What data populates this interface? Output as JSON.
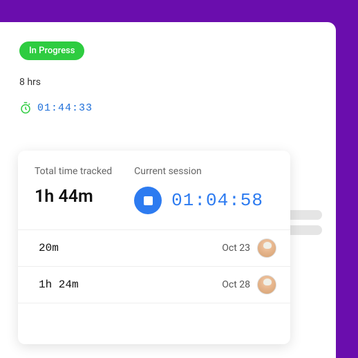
{
  "status": {
    "label": "In Progress"
  },
  "summary": {
    "hours": "8 hrs",
    "tracked_time": "01:44:33"
  },
  "popover": {
    "total_label": "Total time tracked",
    "total_value": "1h 44m",
    "session_label": "Current session",
    "session_value": "01:04:58",
    "sessions": [
      {
        "duration": "20m",
        "date": "Oct 23"
      },
      {
        "duration": "1h 24m",
        "date": "Oct 28"
      }
    ]
  }
}
